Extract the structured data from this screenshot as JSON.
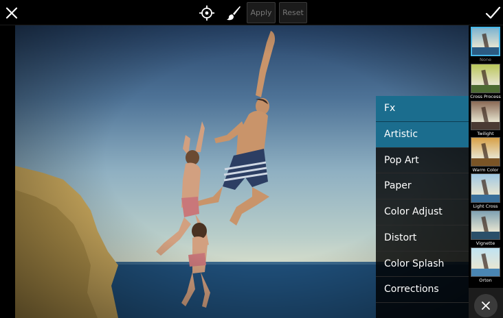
{
  "toolbar": {
    "apply_label": "Apply",
    "reset_label": "Reset"
  },
  "menu": {
    "items": [
      {
        "label": "Fx",
        "state": "header"
      },
      {
        "label": "Artistic",
        "state": "selected"
      },
      {
        "label": "Pop Art",
        "state": ""
      },
      {
        "label": "Paper",
        "state": ""
      },
      {
        "label": "Color Adjust",
        "state": ""
      },
      {
        "label": "Distort",
        "state": ""
      },
      {
        "label": "Color Splash",
        "state": ""
      },
      {
        "label": "Corrections",
        "state": ""
      }
    ]
  },
  "filters": {
    "items": [
      {
        "label": "None",
        "selected": true,
        "tint": "#7db3cf"
      },
      {
        "label": "Cross Process",
        "selected": false,
        "tint": "#b9c65a"
      },
      {
        "label": "Twilight",
        "selected": false,
        "tint": "#8a6a55"
      },
      {
        "label": "Warm Color",
        "selected": false,
        "tint": "#d7a046"
      },
      {
        "label": "Light Cross",
        "selected": false,
        "tint": "#9fc7e3"
      },
      {
        "label": "Vignette",
        "selected": false,
        "tint": "#7fa1b2"
      },
      {
        "label": "Orton",
        "selected": false,
        "tint": "#bfe3f2"
      }
    ]
  },
  "colors": {
    "accent": "#1b6d8e",
    "selection_border": "#46b7e8"
  },
  "icons": {
    "close": "close-icon",
    "target": "crosshair-icon",
    "brush": "brush-icon",
    "confirm": "check-icon"
  }
}
